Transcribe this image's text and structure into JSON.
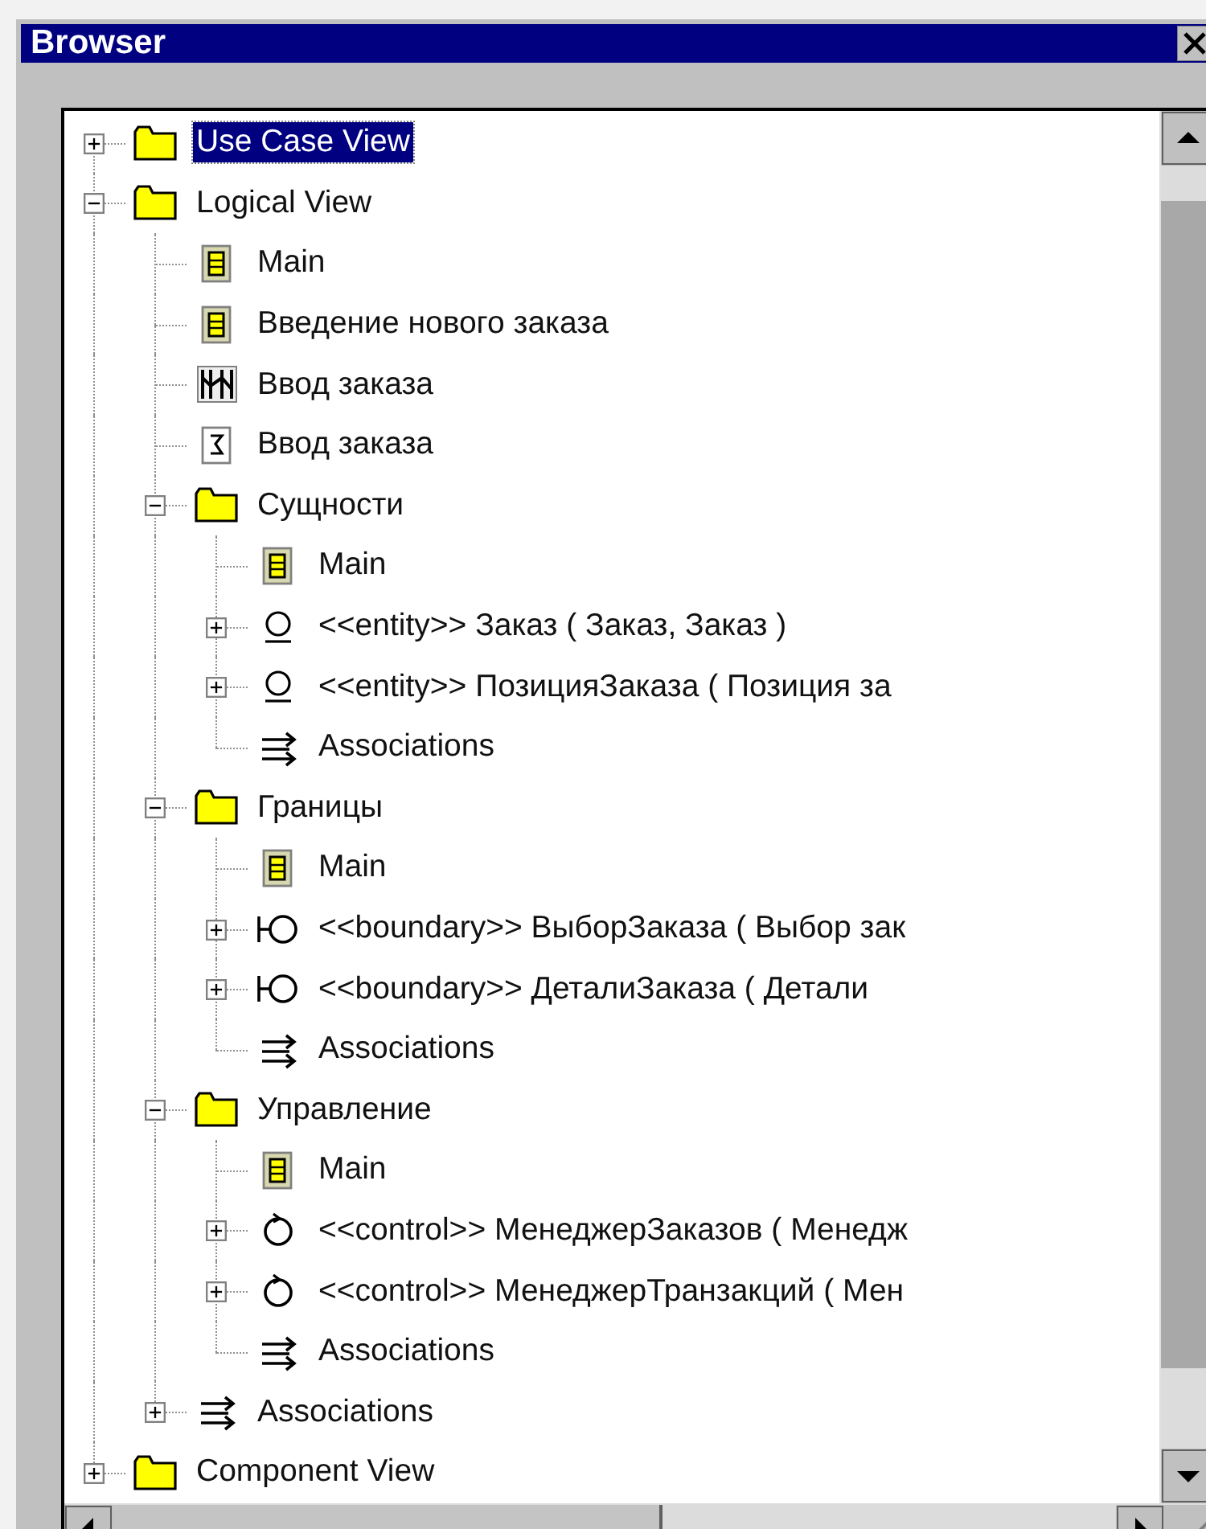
{
  "window": {
    "title": "Browser"
  },
  "tree": [
    {
      "label": "Use Case View",
      "kind": "folder",
      "expanded": false,
      "selected": true
    },
    {
      "label": "Logical View",
      "kind": "folder",
      "expanded": true,
      "selected": false,
      "children": [
        {
          "label": "Main",
          "kind": "class-diagram",
          "selected": false
        },
        {
          "label": "Введение нового заказа",
          "kind": "class-diagram",
          "selected": false
        },
        {
          "label": "Ввод заказа",
          "kind": "collaboration-diagram",
          "selected": false
        },
        {
          "label": "Ввод заказа",
          "kind": "sequence-diagram",
          "selected": false
        },
        {
          "label": "Сущности",
          "kind": "folder",
          "expanded": true,
          "selected": false,
          "children": [
            {
              "label": "Main",
              "kind": "class-diagram",
              "selected": false
            },
            {
              "label": "<<entity>> Заказ ( Заказ, Заказ )",
              "kind": "entity",
              "expanded": false,
              "selected": false
            },
            {
              "label": "<<entity>> ПозицияЗаказа ( Позиция за",
              "kind": "entity",
              "expanded": false,
              "selected": false
            },
            {
              "label": "Associations",
              "kind": "associations",
              "selected": false
            }
          ]
        },
        {
          "label": "Границы",
          "kind": "folder",
          "expanded": true,
          "selected": false,
          "children": [
            {
              "label": "Main",
              "kind": "class-diagram",
              "selected": false
            },
            {
              "label": "<<boundary>> ВыборЗаказа ( Выбор зак",
              "kind": "boundary",
              "expanded": false,
              "selected": false
            },
            {
              "label": "<<boundary>> ДеталиЗаказа ( Детали",
              "kind": "boundary",
              "expanded": false,
              "selected": false
            },
            {
              "label": "Associations",
              "kind": "associations",
              "selected": false
            }
          ]
        },
        {
          "label": "Управление",
          "kind": "folder",
          "expanded": true,
          "selected": false,
          "children": [
            {
              "label": "Main",
              "kind": "class-diagram",
              "selected": false
            },
            {
              "label": "<<control>> МенеджерЗаказов ( Менедж",
              "kind": "control",
              "expanded": false,
              "selected": false
            },
            {
              "label": "<<control>> МенеджерТранзакций ( Мен",
              "kind": "control",
              "expanded": false,
              "selected": false
            },
            {
              "label": "Associations",
              "kind": "associations",
              "selected": false
            }
          ]
        },
        {
          "label": "Associations",
          "kind": "associations",
          "expanded": false,
          "selected": false
        }
      ]
    },
    {
      "label": "Component View",
      "kind": "folder",
      "expanded": false,
      "selected": false
    }
  ]
}
